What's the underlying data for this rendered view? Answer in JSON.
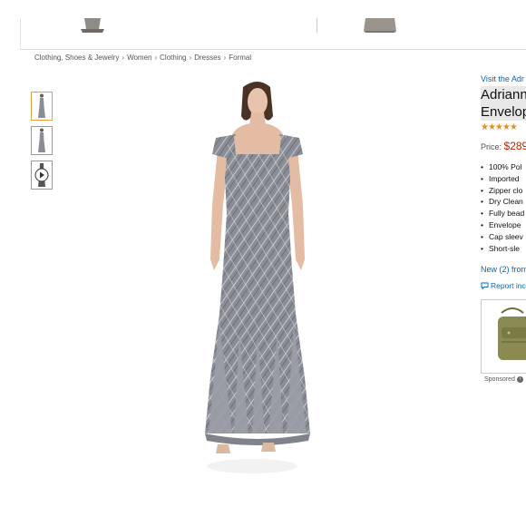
{
  "breadcrumb": {
    "items": [
      "Clothing, Shoes & Jewelry",
      "Women",
      "Clothing",
      "Dresses",
      "Formal"
    ],
    "separator": "›"
  },
  "product": {
    "brand_link": "Visit the Adr",
    "title_line1": "Adrianna",
    "title_line2": "Envelop",
    "rating_stars": 4.5,
    "price_label": "Price:",
    "price_value": "$289",
    "bullets": [
      "100% Pol",
      "Imported",
      "Zipper clo",
      "Dry Clean",
      "Fully bead",
      "Envelope",
      "Cap sleev",
      "Short-sle"
    ],
    "new_from": "New (2) from",
    "report": "Report inc"
  },
  "ad": {
    "sponsored_label": "Sponsored"
  },
  "colors": {
    "link": "#0066c0",
    "price": "#b12704",
    "star": "#e88c1f",
    "thumb_active_border": "#e7a03c",
    "dress": "#8a8d96"
  },
  "icons": {
    "report": "speech-bubble-icon",
    "info": "info-icon",
    "play": "play-icon"
  }
}
